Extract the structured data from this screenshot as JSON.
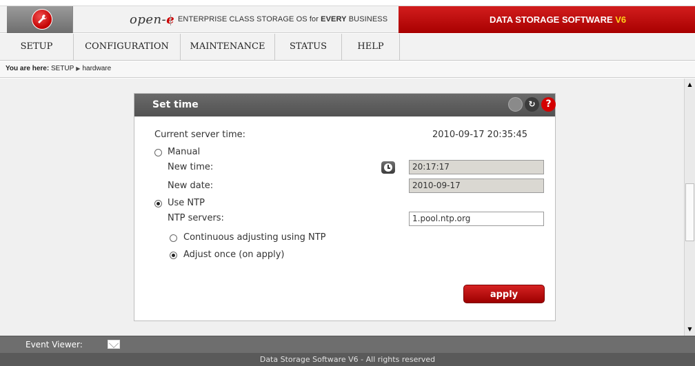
{
  "header": {
    "brand_prefix": "open-",
    "brand_suffix": "e",
    "tagline_start": "ENTERPRISE CLASS STORAGE OS for ",
    "tagline_bold": "EVERY",
    "tagline_end": " BUSINESS",
    "product_name": "DATA STORAGE SOFTWARE ",
    "product_version": "V6",
    "logo_icon": "wrench-icon"
  },
  "menu": {
    "items": [
      {
        "label": "SETUP"
      },
      {
        "label": "CONFIGURATION"
      },
      {
        "label": "MAINTENANCE"
      },
      {
        "label": "STATUS"
      },
      {
        "label": "HELP"
      }
    ]
  },
  "breadcrumb": {
    "prefix": "You are here:",
    "path": [
      "SETUP",
      "hardware"
    ]
  },
  "panel": {
    "title": "Set time",
    "current_time_label": "Current server time:",
    "current_time_value": "2010-09-17 20:35:45",
    "manual_label": "Manual",
    "manual_selected": false,
    "new_time_label": "New time:",
    "new_time_value": "20:17:17",
    "new_date_label": "New date:",
    "new_date_value": "2010-09-17",
    "ntp_label": "Use NTP",
    "ntp_selected": true,
    "ntp_servers_label": "NTP servers:",
    "ntp_servers_value": "1.pool.ntp.org",
    "continuous_label": "Continuous adjusting using NTP",
    "continuous_selected": false,
    "once_label": "Adjust once (on apply)",
    "once_selected": true,
    "apply_label": "apply"
  },
  "bottom": {
    "event_viewer_label": "Event Viewer:",
    "footer_text": "Data Storage Software V6 - All rights reserved"
  },
  "colors": {
    "accent_red": "#c00000",
    "version_yellow": "#ffd21a",
    "panel_title_bg": "#5e5e5e"
  }
}
